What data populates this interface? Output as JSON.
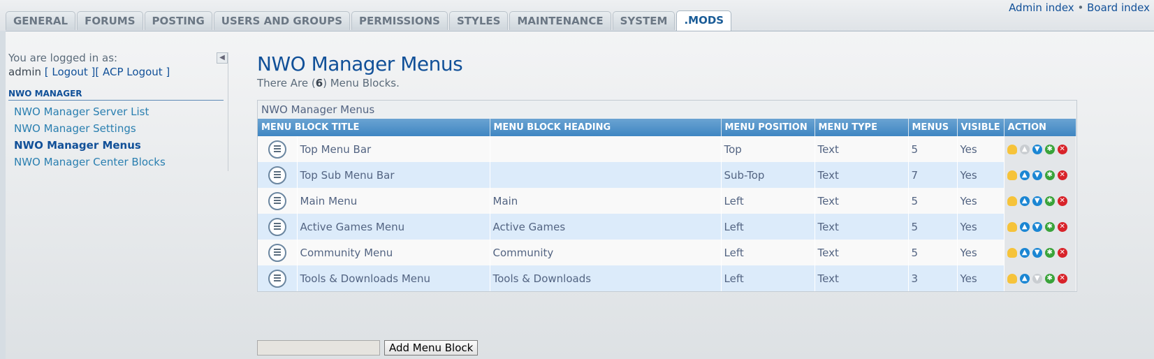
{
  "tabs": [
    "GENERAL",
    "FORUMS",
    "POSTING",
    "USERS AND GROUPS",
    "PERMISSIONS",
    "STYLES",
    "MAINTENANCE",
    "SYSTEM",
    ".MODS"
  ],
  "active_tab": 8,
  "toplinks": {
    "admin_index": "Admin index",
    "sep": "•",
    "board_index": "Board index"
  },
  "sidebar": {
    "logged_in_as": "You are logged in as:",
    "username": "admin",
    "logout": "[ Logout ]",
    "acp_logout": "[ ACP Logout ]",
    "section": "NWO MANAGER",
    "items": [
      {
        "label": "NWO Manager Server List"
      },
      {
        "label": "NWO Manager Settings"
      },
      {
        "label": "NWO Manager Menus"
      },
      {
        "label": "NWO Manager Center Blocks"
      }
    ]
  },
  "main": {
    "title": "NWO Manager Menus",
    "subtitle_pre": "There Are (",
    "count": "6",
    "subtitle_post": ") Menu Blocks.",
    "table_caption": "NWO Manager Menus",
    "columns": [
      "MENU BLOCK TITLE",
      "MENU BLOCK HEADING",
      "MENU POSITION",
      "MENU TYPE",
      "MENUS",
      "VISIBLE",
      "ACTION"
    ],
    "rows": [
      {
        "title": "Top Menu Bar",
        "heading": "",
        "position": "Top",
        "type": "Text",
        "menus": "5",
        "visible": "Yes",
        "up_enabled": false,
        "down_enabled": true
      },
      {
        "title": "Top Sub Menu Bar",
        "heading": "",
        "position": "Sub-Top",
        "type": "Text",
        "menus": "7",
        "visible": "Yes",
        "up_enabled": true,
        "down_enabled": true
      },
      {
        "title": "Main Menu",
        "heading": "Main",
        "position": "Left",
        "type": "Text",
        "menus": "5",
        "visible": "Yes",
        "up_enabled": true,
        "down_enabled": true
      },
      {
        "title": "Active Games Menu",
        "heading": "Active Games",
        "position": "Left",
        "type": "Text",
        "menus": "5",
        "visible": "Yes",
        "up_enabled": true,
        "down_enabled": true
      },
      {
        "title": "Community Menu",
        "heading": "Community",
        "position": "Left",
        "type": "Text",
        "menus": "5",
        "visible": "Yes",
        "up_enabled": true,
        "down_enabled": true
      },
      {
        "title": "Tools & Downloads Menu",
        "heading": "Tools & Downloads",
        "position": "Left",
        "type": "Text",
        "menus": "3",
        "visible": "Yes",
        "up_enabled": true,
        "down_enabled": false
      }
    ],
    "add_input_value": "",
    "add_button": "Add Menu Block"
  }
}
